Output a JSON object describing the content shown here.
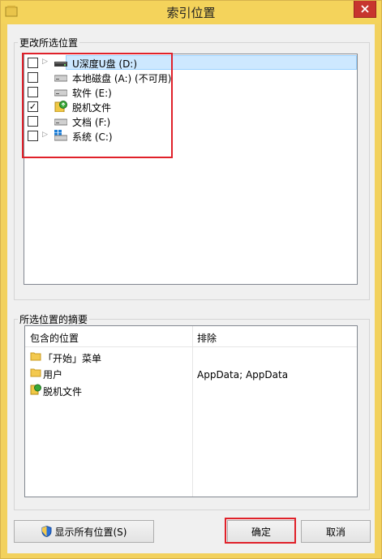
{
  "window": {
    "title": "索引位置"
  },
  "change_group": {
    "legend": "更改所选位置",
    "items": [
      {
        "label": "U深度U盘 (D:)",
        "checked": false,
        "expandable": true,
        "icon": "usb-drive-icon",
        "selected": true
      },
      {
        "label": "本地磁盘 (A:) (不可用)",
        "checked": false,
        "expandable": false,
        "icon": "drive-icon",
        "selected": false
      },
      {
        "label": "软件 (E:)",
        "checked": false,
        "expandable": false,
        "icon": "drive-icon",
        "selected": false
      },
      {
        "label": "脱机文件",
        "checked": true,
        "expandable": false,
        "icon": "offline-files-icon",
        "selected": false
      },
      {
        "label": "文档 (F:)",
        "checked": false,
        "expandable": false,
        "icon": "drive-icon",
        "selected": false
      },
      {
        "label": "系统 (C:)",
        "checked": false,
        "expandable": true,
        "icon": "system-drive-icon",
        "selected": false
      }
    ],
    "check_mark": "✓"
  },
  "summary_group": {
    "legend": "所选位置的摘要",
    "columns": [
      "包含的位置",
      "排除"
    ],
    "rows": [
      {
        "location": "「开始」菜单",
        "exclude": "",
        "icon": "folder-icon"
      },
      {
        "location": "用户",
        "exclude": "AppData; AppData",
        "icon": "folder-icon"
      },
      {
        "location": "脱机文件",
        "exclude": "",
        "icon": "offline-files-icon"
      }
    ]
  },
  "buttons": {
    "show_all": "显示所有位置(S)",
    "ok": "确定",
    "cancel": "取消"
  },
  "colors": {
    "titlebar": "#f4d35b",
    "close": "#c7352e",
    "highlight": "#e0212a",
    "selection": "#cde8ff"
  }
}
